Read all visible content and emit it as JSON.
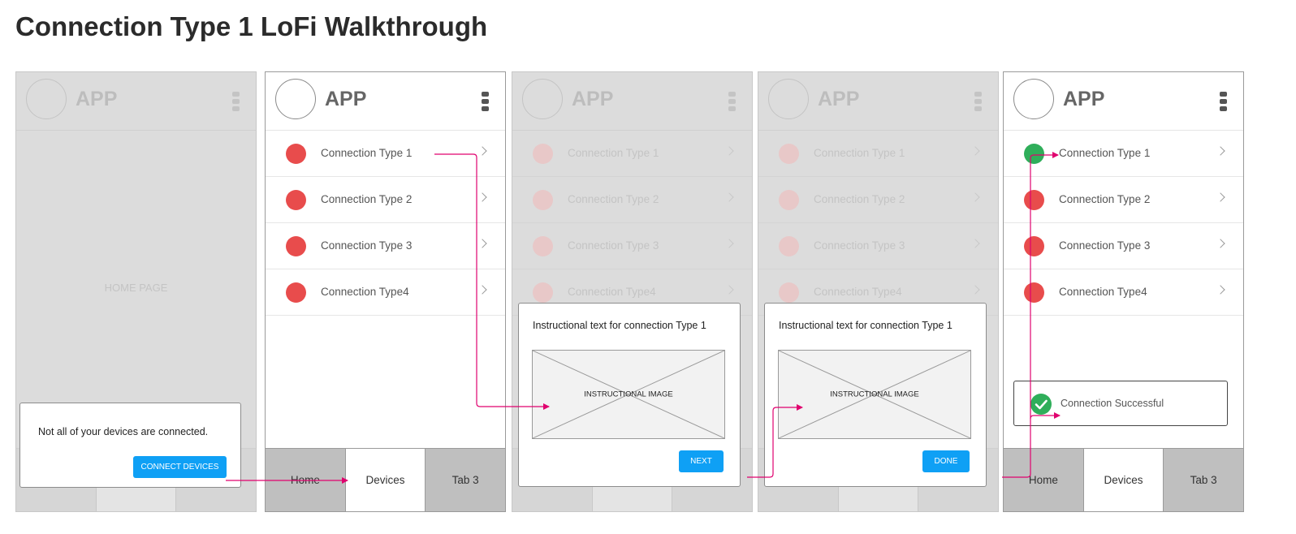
{
  "page": {
    "title": "Connection Type 1 LoFi Walkthrough"
  },
  "app": {
    "name": "APP"
  },
  "connections": [
    {
      "label": "Connection Type 1"
    },
    {
      "label": "Connection Type 2"
    },
    {
      "label": "Connection Type 3"
    },
    {
      "label": "Connection Type4"
    }
  ],
  "tabs": {
    "home": "Home",
    "devices": "Devices",
    "tab3": "Tab 3"
  },
  "screen1": {
    "home_label": "HOME PAGE",
    "modal_text": "Not all of your devices are connected.",
    "button_label": "CONNECT DEVICES"
  },
  "screen3": {
    "modal_text": "Instructional text for connection Type 1",
    "image_label": "INSTRUCTIONAL IMAGE",
    "button_label": "NEXT"
  },
  "screen4": {
    "modal_text": "Instructional text for connection Type 1",
    "image_label": "INSTRUCTIONAL IMAGE",
    "button_label": "DONE"
  },
  "screen5": {
    "toast_label": "Connection Successful"
  },
  "colors": {
    "status_not_connected": "#e84c4c",
    "status_connected": "#2fae5a",
    "primary_button": "#0fa0f5",
    "connector": "#e0006e"
  },
  "icons": {
    "menu": "kebab-menu-icon",
    "row_chevron": "chevron-right-icon",
    "success": "check-circle-icon"
  }
}
